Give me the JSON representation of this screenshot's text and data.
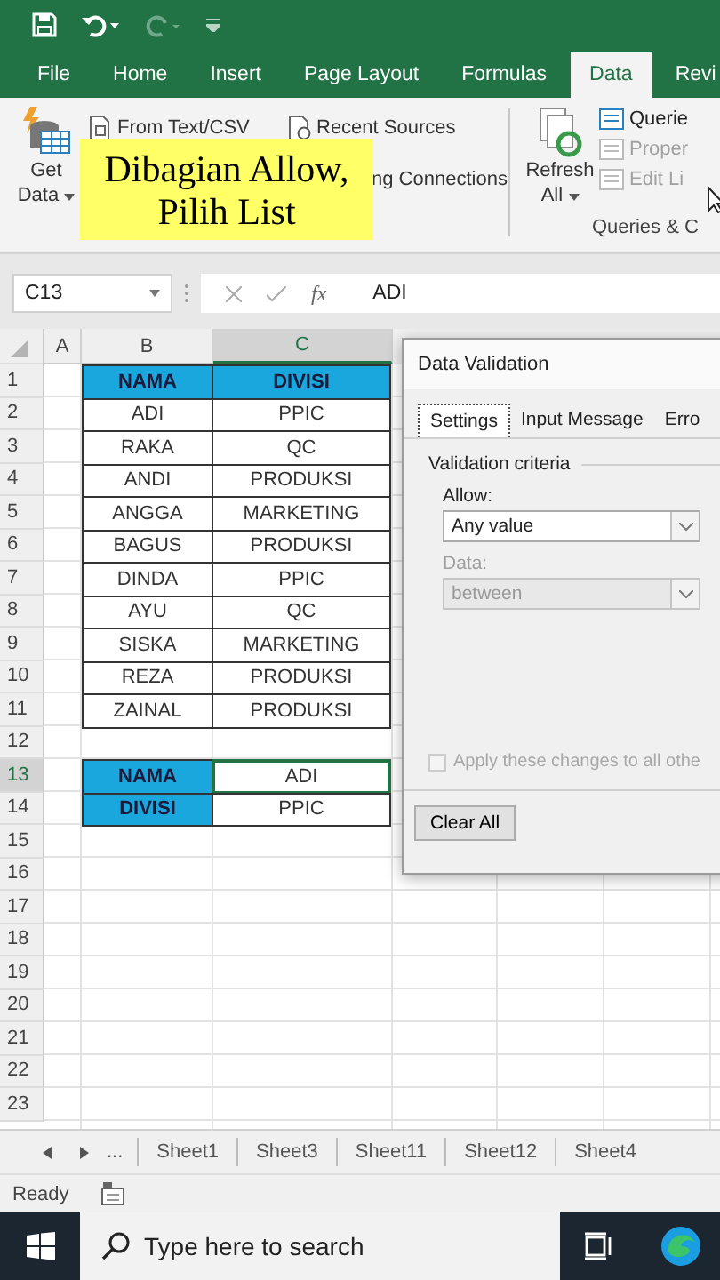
{
  "ribbon_tabs": [
    {
      "label": "File",
      "selected": false
    },
    {
      "label": "Home",
      "selected": false
    },
    {
      "label": "Insert",
      "selected": false
    },
    {
      "label": "Page Layout",
      "selected": false
    },
    {
      "label": "Formulas",
      "selected": false
    },
    {
      "label": "Data",
      "selected": true
    },
    {
      "label": "Revi",
      "selected": false
    }
  ],
  "ribbon": {
    "get_data": [
      "Get",
      "Data"
    ],
    "small_buttons": [
      {
        "label": "From Text/CSV"
      },
      {
        "label": "Recent Sources"
      },
      {
        "label": "ng Connections"
      }
    ],
    "refresh": [
      "Refresh",
      "All"
    ],
    "queries": [
      {
        "label": "Querie",
        "disabled": false
      },
      {
        "label": "Proper",
        "disabled": true
      },
      {
        "label": "Edit Li",
        "disabled": true
      }
    ],
    "queries_group": "Queries & C"
  },
  "caption": {
    "lines": [
      "Dibagian Allow,",
      "Pilih List"
    ]
  },
  "formula_bar": {
    "name_box": "C13",
    "fx": "fx",
    "formula": "ADI"
  },
  "sheet": {
    "columns": [
      {
        "label": "A",
        "selected": false
      },
      {
        "label": "B",
        "selected": false
      },
      {
        "label": "C",
        "selected": true
      }
    ],
    "rows": [
      {
        "number": "1",
        "selected": false,
        "cells": [
          {
            "text": "NAMA",
            "kind": "header",
            "selected": false
          },
          {
            "text": "DIVISI",
            "kind": "header",
            "selected": false
          }
        ]
      },
      {
        "number": "2",
        "selected": false,
        "cells": [
          {
            "text": "ADI",
            "kind": "data",
            "selected": false
          },
          {
            "text": "PPIC",
            "kind": "data",
            "selected": false
          }
        ]
      },
      {
        "number": "3",
        "selected": false,
        "cells": [
          {
            "text": "RAKA",
            "kind": "data",
            "selected": false
          },
          {
            "text": "QC",
            "kind": "data",
            "selected": false
          }
        ]
      },
      {
        "number": "4",
        "selected": false,
        "cells": [
          {
            "text": "ANDI",
            "kind": "data",
            "selected": false
          },
          {
            "text": "PRODUKSI",
            "kind": "data",
            "selected": false
          }
        ]
      },
      {
        "number": "5",
        "selected": false,
        "cells": [
          {
            "text": "ANGGA",
            "kind": "data",
            "selected": false
          },
          {
            "text": "MARKETING",
            "kind": "data",
            "selected": false
          }
        ]
      },
      {
        "number": "6",
        "selected": false,
        "cells": [
          {
            "text": "BAGUS",
            "kind": "data",
            "selected": false
          },
          {
            "text": "PRODUKSI",
            "kind": "data",
            "selected": false
          }
        ]
      },
      {
        "number": "7",
        "selected": false,
        "cells": [
          {
            "text": "DINDA",
            "kind": "data",
            "selected": false
          },
          {
            "text": "PPIC",
            "kind": "data",
            "selected": false
          }
        ]
      },
      {
        "number": "8",
        "selected": false,
        "cells": [
          {
            "text": "AYU",
            "kind": "data",
            "selected": false
          },
          {
            "text": "QC",
            "kind": "data",
            "selected": false
          }
        ]
      },
      {
        "number": "9",
        "selected": false,
        "cells": [
          {
            "text": "SISKA",
            "kind": "data",
            "selected": false
          },
          {
            "text": "MARKETING",
            "kind": "data",
            "selected": false
          }
        ]
      },
      {
        "number": "10",
        "selected": false,
        "cells": [
          {
            "text": "REZA",
            "kind": "data",
            "selected": false
          },
          {
            "text": "PRODUKSI",
            "kind": "data",
            "selected": false
          }
        ]
      },
      {
        "number": "11",
        "selected": false,
        "cells": [
          {
            "text": "ZAINAL",
            "kind": "data",
            "selected": false
          },
          {
            "text": "PRODUKSI",
            "kind": "data",
            "selected": false
          }
        ]
      },
      {
        "number": "12",
        "selected": false
      },
      {
        "number": "13",
        "selected": true,
        "cells": [
          {
            "text": "NAMA",
            "kind": "header",
            "selected": false
          },
          {
            "text": "ADI",
            "kind": "data",
            "selected": true
          }
        ]
      },
      {
        "number": "14",
        "selected": false,
        "cells": [
          {
            "text": "DIVISI",
            "kind": "header",
            "selected": false
          },
          {
            "text": "PPIC",
            "kind": "data",
            "selected": false
          }
        ]
      },
      {
        "number": "15",
        "selected": false
      },
      {
        "number": "16",
        "selected": false
      },
      {
        "number": "17",
        "selected": false
      },
      {
        "number": "18",
        "selected": false
      },
      {
        "number": "19",
        "selected": false
      },
      {
        "number": "20",
        "selected": false
      },
      {
        "number": "21",
        "selected": false
      },
      {
        "number": "22",
        "selected": false
      },
      {
        "number": "23",
        "selected": false
      }
    ]
  },
  "dialog": {
    "title": "Data Validation",
    "tabs": [
      {
        "label": "Settings",
        "selected": true
      },
      {
        "label": "Input Message",
        "selected": false
      },
      {
        "label": "Erro",
        "selected": false
      }
    ],
    "section": "Validation criteria",
    "fields": [
      {
        "label": "Allow:",
        "value": "Any value",
        "disabled": false
      },
      {
        "label": "Data:",
        "value": "between",
        "disabled": true
      }
    ],
    "apply_all": {
      "label": "Apply these changes to all othe",
      "checked": false,
      "disabled": true
    },
    "clear_button": "Clear All"
  },
  "sheet_tabs": {
    "more": "...",
    "tabs": [
      "Sheet1",
      "Sheet3",
      "Sheet11",
      "Sheet12",
      "Sheet4"
    ]
  },
  "status_bar": {
    "text": "Ready"
  },
  "taskbar": {
    "search_placeholder": "Type here to search"
  }
}
